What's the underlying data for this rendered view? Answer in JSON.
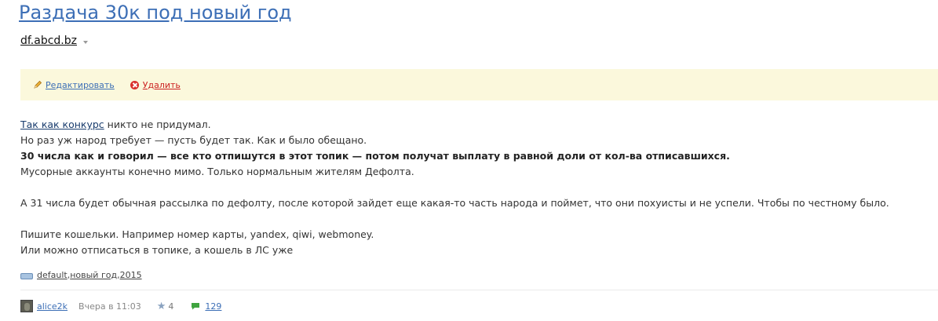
{
  "topic": {
    "title": "Раздача 30к под новый год",
    "blog": "df.abcd.bz"
  },
  "actions": {
    "edit": "Редактировать",
    "delete": "Удалить"
  },
  "content": {
    "line1_link": "Так как конкурс",
    "line1_rest": " никто не придумал.",
    "line2": "Но раз уж народ требует — пусть будет так. Как и было обещано.",
    "line3_bold": "30 числа как и говорил — все кто отпишутся в этот топик — потом получат выплату в равной доли от кол-ва отписавшихся.",
    "line4": "Мусорные аккаунты конечно мимо. Только нормальным жителям Дефолта.",
    "line5": "А 31 числа будет обычная рассылка по дефолту, после которой зайдет еще какая-то часть народа и поймет, что они похуисты и не успели. Чтобы по честному было.",
    "line6": "Пишите кошельки. Например номер карты, yandex, qiwi, webmoney.",
    "line7": "Или можно отписаться в топике, а кошель в ЛС уже"
  },
  "tags": [
    "default",
    "новый год",
    "2015"
  ],
  "tag_separator": ", ",
  "info": {
    "author": "alice2k",
    "date": "Вчера в 11:03",
    "rating": "4",
    "comments": "129"
  },
  "colors": {
    "link": "#3d6fb6",
    "action_bar": "#fbf8dc",
    "delete": "#cc2222"
  }
}
